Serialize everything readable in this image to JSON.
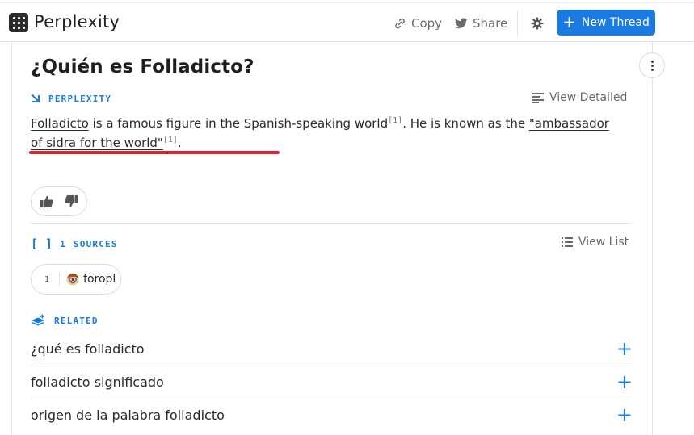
{
  "header": {
    "app_title": "Perplexity",
    "copy_label": "Copy",
    "share_label": "Share",
    "new_thread_label": "New Thread"
  },
  "thread": {
    "question": "¿Quién es Folladicto?",
    "answer_label": "PERPLEXITY",
    "view_detailed_label": "View Detailed",
    "answer": {
      "part1_link": "Folladicto",
      "part2": " is a famous figure in the Spanish-speaking world",
      "cite1": "[1]",
      "part3": ". He is known as the ",
      "quote_link": "\"ambassador of sidra for the world\"",
      "cite2": "[1]",
      "part4": "."
    }
  },
  "sources": {
    "count": "1",
    "label": "SOURCES",
    "view_list_label": "View List",
    "items": [
      {
        "number": "1",
        "name": "foropl"
      }
    ]
  },
  "related": {
    "label": "RELATED",
    "items": [
      {
        "text": "¿qué es folladicto"
      },
      {
        "text": "folladicto significado"
      },
      {
        "text": "origen de la palabra folladicto"
      }
    ]
  },
  "colors": {
    "accent": "#1a7ae0",
    "highlight_underline": "#d9232e"
  }
}
